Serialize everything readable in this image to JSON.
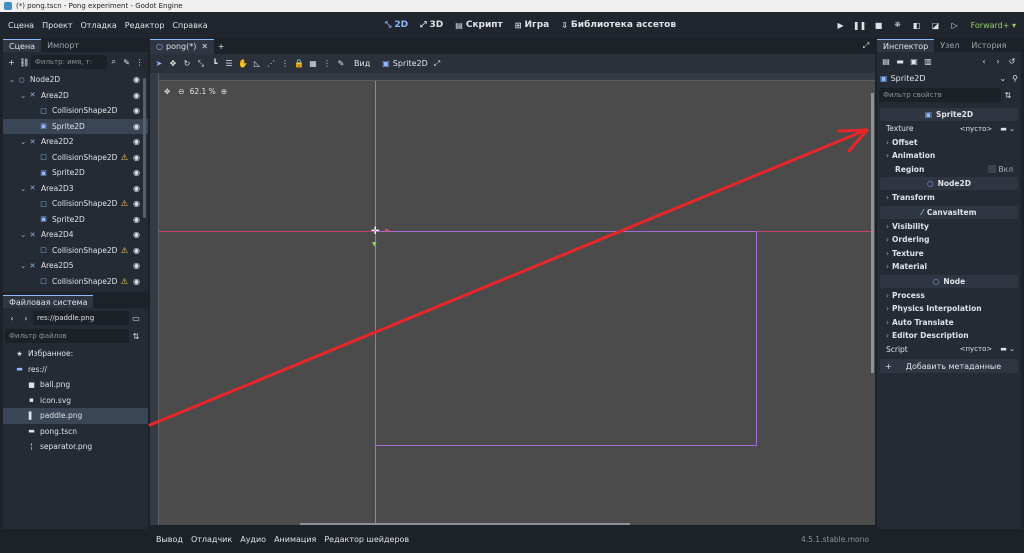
{
  "window": {
    "title": "(*) pong.tscn - Pong experiment - Godot Engine"
  },
  "menu": [
    "Сцена",
    "Проект",
    "Отладка",
    "Редактор",
    "Справка"
  ],
  "workspaces": [
    {
      "label": "2D",
      "icon": "⤡"
    },
    {
      "label": "3D",
      "icon": "⤢"
    },
    {
      "label": "Скрипт",
      "icon": "▤"
    },
    {
      "label": "Игра",
      "icon": "⊞"
    },
    {
      "label": "Библиотека ассетов",
      "icon": "⇩"
    }
  ],
  "renderer": "Forward+",
  "scene_dock": {
    "tabs": [
      "Сцена",
      "Импорт"
    ],
    "filter_placeholder": "Фильтр: имя, т:",
    "nodes": [
      {
        "label": "Node2D",
        "depth": 0,
        "icon": "○",
        "color": "#8fb8ff",
        "warn": false
      },
      {
        "label": "Area2D",
        "depth": 1,
        "icon": "✕",
        "color": "#8fb8ff",
        "warn": false
      },
      {
        "label": "CollisionShape2D",
        "depth": 2,
        "icon": "□",
        "color": "#8fb8ff",
        "warn": false
      },
      {
        "label": "Sprite2D",
        "depth": 2,
        "icon": "▣",
        "color": "#8fb8ff",
        "warn": false
      },
      {
        "label": "Area2D2",
        "depth": 1,
        "icon": "✕",
        "color": "#8fb8ff",
        "warn": false
      },
      {
        "label": "CollisionShape2D",
        "depth": 2,
        "icon": "□",
        "color": "#8fb8ff",
        "warn": true
      },
      {
        "label": "Sprite2D",
        "depth": 2,
        "icon": "▣",
        "color": "#8fb8ff",
        "warn": false
      },
      {
        "label": "Area2D3",
        "depth": 1,
        "icon": "✕",
        "color": "#8fb8ff",
        "warn": false
      },
      {
        "label": "CollisionShape2D",
        "depth": 2,
        "icon": "□",
        "color": "#8fb8ff",
        "warn": true
      },
      {
        "label": "Sprite2D",
        "depth": 2,
        "icon": "▣",
        "color": "#8fb8ff",
        "warn": false
      },
      {
        "label": "Area2D4",
        "depth": 1,
        "icon": "✕",
        "color": "#8fb8ff",
        "warn": false
      },
      {
        "label": "CollisionShape2D",
        "depth": 2,
        "icon": "□",
        "color": "#8fb8ff",
        "warn": true
      },
      {
        "label": "Area2D5",
        "depth": 1,
        "icon": "✕",
        "color": "#8fb8ff",
        "warn": false
      },
      {
        "label": "CollisionShape2D",
        "depth": 2,
        "icon": "□",
        "color": "#8fb8ff",
        "warn": true
      }
    ],
    "selected": "Sprite2D"
  },
  "filesystem": {
    "title": "Файловая система",
    "path": "res://paddle.png",
    "filter_placeholder": "Фильтр файлов",
    "items": [
      {
        "label": "Избранное:",
        "icon": "★",
        "indent": 1,
        "sel": false
      },
      {
        "label": "res://",
        "icon": "▬",
        "indent": 1,
        "sel": false
      },
      {
        "label": "ball.png",
        "icon": "■",
        "indent": 2,
        "sel": false
      },
      {
        "label": "icon.svg",
        "icon": "▪",
        "indent": 2,
        "sel": false
      },
      {
        "label": "paddle.png",
        "icon": "▌",
        "indent": 2,
        "sel": true
      },
      {
        "label": "pong.tscn",
        "icon": "▬",
        "indent": 2,
        "sel": false
      },
      {
        "label": "separator.png",
        "icon": "╎",
        "indent": 2,
        "sel": false
      }
    ]
  },
  "editor": {
    "tab": "pong(*)",
    "zoom": "62.1 %",
    "view_label": "Вид",
    "sprite_label": "Sprite2D"
  },
  "bottom": {
    "tabs": [
      "Вывод",
      "Отладчик",
      "Аудио",
      "Анимация",
      "Редактор шейдеров"
    ],
    "version": "4.5.1.stable.mono"
  },
  "inspector": {
    "tabs": [
      "Инспектор",
      "Узел",
      "История"
    ],
    "object": "Sprite2D",
    "filter_placeholder": "Фильтр свойств",
    "sections": [
      {
        "kind": "header",
        "label": "Sprite2D",
        "icon": "▣"
      },
      {
        "kind": "value",
        "label": "Texture",
        "value": "<пусто>"
      },
      {
        "kind": "group",
        "label": "Offset"
      },
      {
        "kind": "group",
        "label": "Animation"
      },
      {
        "kind": "check",
        "label": "Region",
        "value": "Вкл"
      },
      {
        "kind": "header",
        "label": "Node2D",
        "icon": "○"
      },
      {
        "kind": "group",
        "label": "Transform"
      },
      {
        "kind": "header",
        "label": "CanvasItem",
        "icon": "⁄"
      },
      {
        "kind": "group",
        "label": "Visibility"
      },
      {
        "kind": "group",
        "label": "Ordering"
      },
      {
        "kind": "group",
        "label": "Texture"
      },
      {
        "kind": "group",
        "label": "Material"
      },
      {
        "kind": "header",
        "label": "Node",
        "icon": "○"
      },
      {
        "kind": "group",
        "label": "Process"
      },
      {
        "kind": "group",
        "label": "Physics Interpolation"
      },
      {
        "kind": "group",
        "label": "Auto Translate"
      },
      {
        "kind": "group",
        "label": "Editor Description"
      },
      {
        "kind": "value",
        "label": "Script",
        "value": "<пусто>"
      }
    ],
    "add_meta": "Добавить метаданные"
  },
  "colors": {
    "accent": "#8fb8ff",
    "annotation_arrow": "#e8262a",
    "viewport_bg": "#4b4b4b",
    "rect_outline": "#a86ad9"
  }
}
